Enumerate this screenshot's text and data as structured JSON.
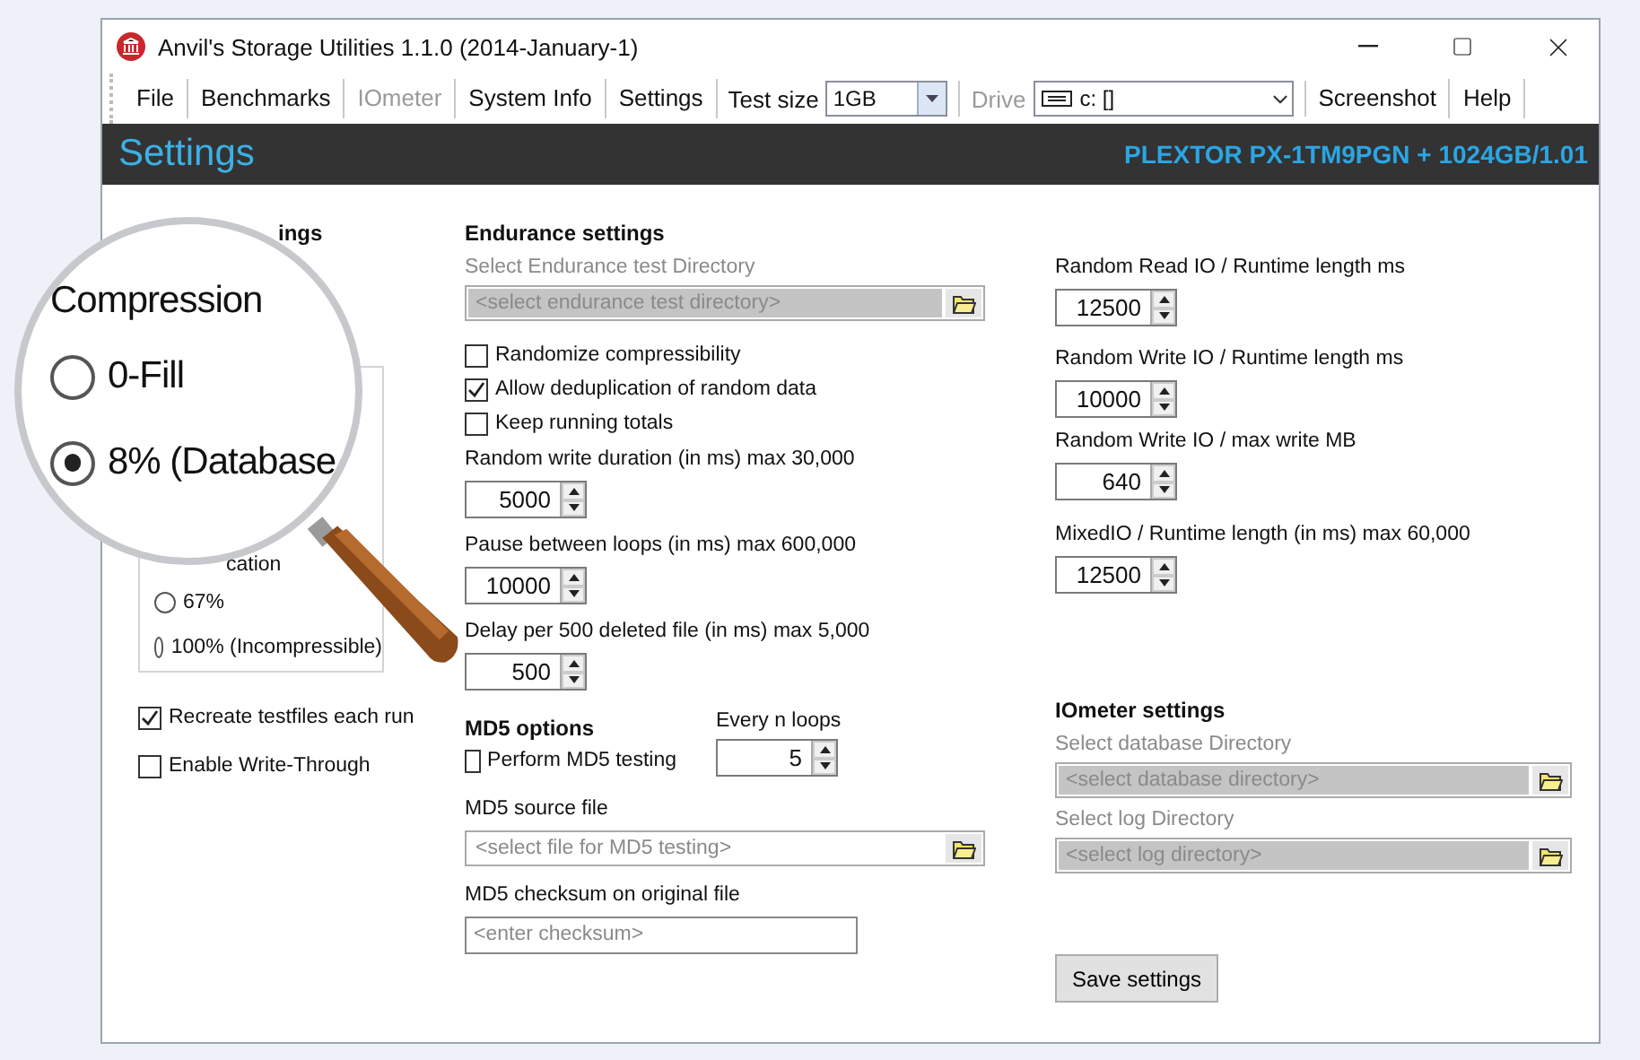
{
  "window": {
    "title": "Anvil's Storage Utilities 1.1.0 (2014-January-1)"
  },
  "menu": [
    {
      "kind": "item",
      "label": "File",
      "disabled": false
    },
    {
      "kind": "item",
      "label": "Benchmarks",
      "disabled": false
    },
    {
      "kind": "item",
      "label": "IOmeter",
      "disabled": true
    },
    {
      "kind": "item",
      "label": "System Info",
      "disabled": false
    },
    {
      "kind": "item",
      "label": "Settings",
      "disabled": false
    },
    {
      "kind": "combo",
      "label": "Test size",
      "value": "1GB",
      "disabled": false
    },
    {
      "kind": "device_combo",
      "label": "Drive",
      "value": "c: []",
      "disabled": true
    },
    {
      "kind": "item",
      "label": "Screenshot",
      "disabled": false
    },
    {
      "kind": "item",
      "label": "Help",
      "disabled": false
    }
  ],
  "header": {
    "title": "Settings",
    "device": "PLEXTOR PX-1TM9PGN + 1024GB/1.01"
  },
  "magnifier": {
    "heading": "Compression",
    "options": [
      {
        "label": "0-Fill",
        "selected": false
      },
      {
        "label": "8% (Database",
        "selected": true
      }
    ]
  },
  "left_panel": {
    "heading_fragment": "ings",
    "option_fragment": "cation",
    "options": [
      {
        "label": "67%",
        "selected": false
      },
      {
        "label": "100% (Incompressible)",
        "selected": false
      }
    ],
    "checkboxes": [
      {
        "label": "Recreate testfiles each run",
        "checked": true
      },
      {
        "label": "Enable Write-Through",
        "checked": false
      }
    ]
  },
  "endurance": {
    "title": "Endurance settings",
    "directory_label": "Select Endurance test Directory",
    "directory_placeholder": "<select endurance test directory>",
    "checkboxes": [
      {
        "label": "Randomize compressibility",
        "checked": false
      },
      {
        "label": "Allow deduplication of random data",
        "checked": true
      },
      {
        "label": "Keep running totals",
        "checked": false
      }
    ],
    "spins": [
      {
        "label": "Random write duration (in ms) max 30,000",
        "value": "5000"
      },
      {
        "label": "Pause between loops (in ms) max 600,000",
        "value": "10000"
      },
      {
        "label": "Delay per 500 deleted file (in ms) max 5,000",
        "value": "500"
      }
    ]
  },
  "md5": {
    "title": "MD5 options",
    "checkbox": {
      "label": "Perform MD5 testing",
      "checked": false
    },
    "loops_label": "Every n loops",
    "loops_value": "5",
    "source_label": "MD5 source file",
    "source_placeholder": "<select file for MD5 testing>",
    "checksum_label": "MD5 checksum on original file",
    "checksum_placeholder": "<enter checksum>"
  },
  "random_io": [
    {
      "label": "Random Read IO / Runtime length ms",
      "value": "12500"
    },
    {
      "label": "Random Write IO / Runtime length ms",
      "value": "10000"
    },
    {
      "label": "Random Write IO / max write MB",
      "value": "640"
    },
    {
      "label": "MixedIO / Runtime length (in ms) max 60,000",
      "value": "12500"
    }
  ],
  "iometer": {
    "title": "IOmeter settings",
    "fields": [
      {
        "label": "Select database Directory",
        "placeholder": "<select database directory>"
      },
      {
        "label": "Select log Directory",
        "placeholder": "<select log directory>"
      }
    ]
  },
  "save_button": "Save settings"
}
